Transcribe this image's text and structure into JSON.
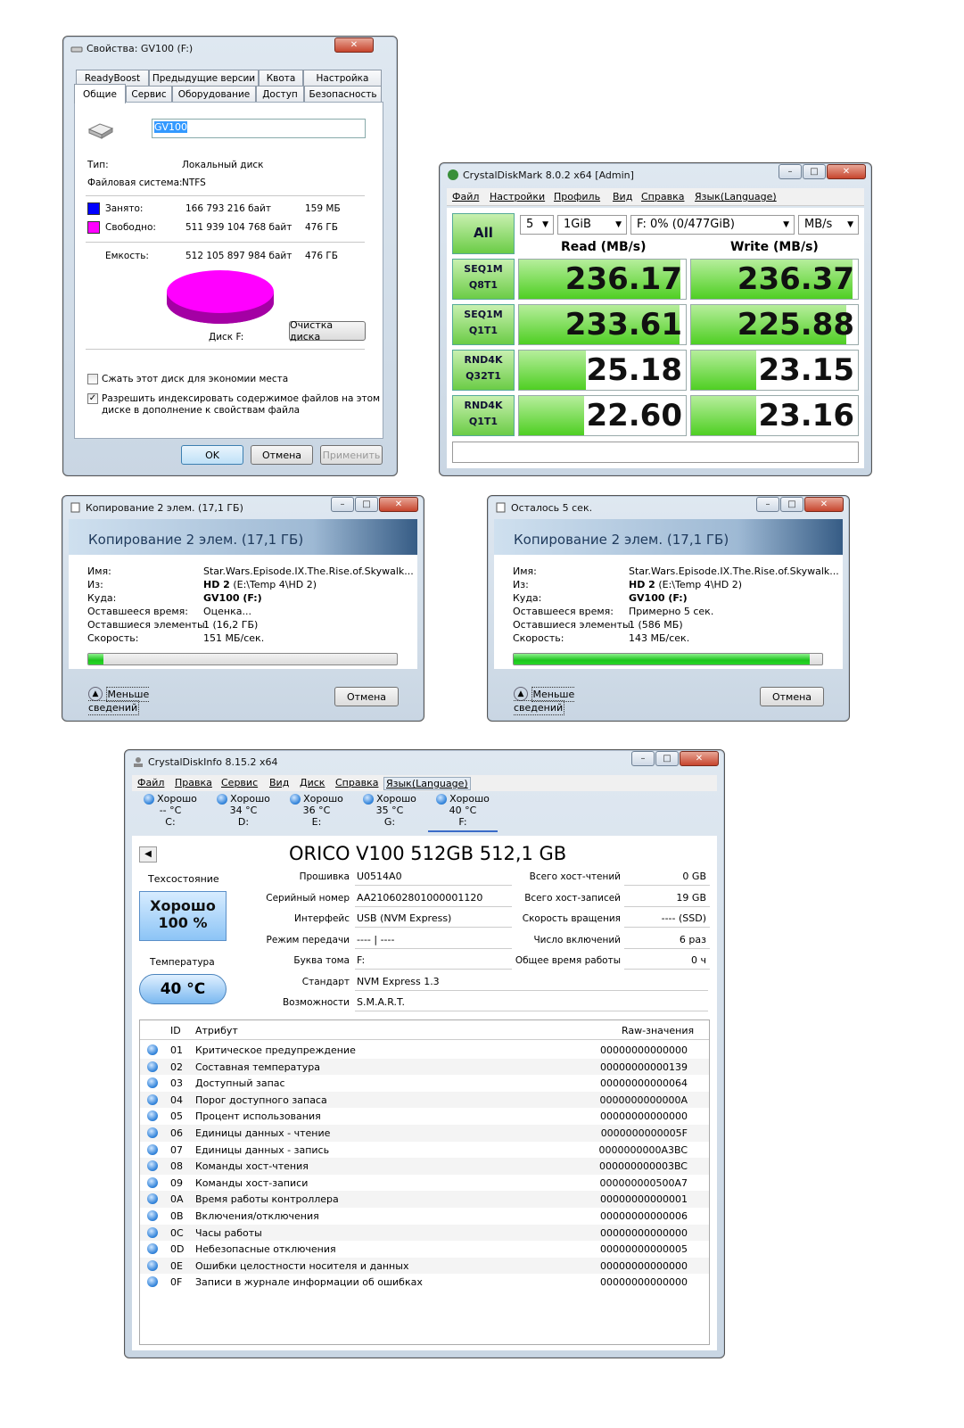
{
  "props": {
    "title": "Свойства: GV100 (F:)",
    "tabs_row1": [
      "ReadyBoost",
      "Предыдущие версии",
      "Квота",
      "Настройка"
    ],
    "tabs_row2": [
      "Общие",
      "Сервис",
      "Оборудование",
      "Доступ",
      "Безопасность"
    ],
    "name_value": "GV100",
    "type_label": "Тип:",
    "type_value": "Локальный диск",
    "fs_label": "Файловая система:",
    "fs_value": "NTFS",
    "used_label": "Занято:",
    "used_bytes": "166 793 216 байт",
    "used_short": "159 МБ",
    "free_label": "Свободно:",
    "free_bytes": "511 939 104 768 байт",
    "free_short": "476 ГБ",
    "cap_label": "Емкость:",
    "cap_bytes": "512 105 897 984 байт",
    "cap_short": "476 ГБ",
    "disk_label": "Диск F:",
    "cleanup": "Очистка диска",
    "compress": "Сжать этот диск для экономии места",
    "index1": "Разрешить индексировать содержимое файлов на этом",
    "index2": "диске в дополнение к свойствам файла",
    "ok": "OK",
    "cancel": "Отмена",
    "apply": "Применить",
    "used_color": "#0000ff",
    "free_color": "#ff00ff"
  },
  "cdm": {
    "title": "CrystalDiskMark 8.0.2 x64 [Admin]",
    "menu": [
      "Файл",
      "Настройки",
      "Профиль",
      "Вид",
      "Справка",
      "Язык(Language)"
    ],
    "all": "All",
    "count": "5",
    "size": "1GiB",
    "drive": "F: 0% (0/477GiB)",
    "unit": "MB/s",
    "read_h": "Read (MB/s)",
    "write_h": "Write (MB/s)",
    "tests": [
      {
        "l1": "SEQ1M",
        "l2": "Q8T1",
        "read": "236.17",
        "write": "236.37",
        "rf": 0.97,
        "wf": 0.97
      },
      {
        "l1": "SEQ1M",
        "l2": "Q1T1",
        "read": "233.61",
        "write": "225.88",
        "rf": 0.96,
        "wf": 0.93
      },
      {
        "l1": "RND4K",
        "l2": "Q32T1",
        "read": "25.18",
        "write": "23.15",
        "rf": 0.4,
        "wf": 0.39
      },
      {
        "l1": "RND4K",
        "l2": "Q1T1",
        "read": "22.60",
        "write": "23.16",
        "rf": 0.39,
        "wf": 0.39
      }
    ]
  },
  "copy1": {
    "title": "Копирование 2 элем. (17,1 ГБ)",
    "banner": "Копирование 2 элем. (17,1 ГБ)",
    "name_l": "Имя:",
    "name_v": "Star.Wars.Episode.IX.The.Rise.of.Skywalk...",
    "from_l": "Из:",
    "from_v1": "HD 2",
    "from_v2": " (E:\\Temp 4\\HD 2)",
    "to_l": "Куда:",
    "to_v": "GV100 (F:)",
    "time_l": "Оставшееся время:",
    "time_v": "Оценка...",
    "items_l": "Оставшиеся элементы:",
    "items_v": "1 (16,2 ГБ)",
    "speed_l": "Скорость:",
    "speed_v": "151 МБ/сек.",
    "progress": 0.05,
    "less": "Меньше сведений",
    "cancel": "Отмена"
  },
  "copy2": {
    "title": "Осталось 5 сек.",
    "banner": "Копирование 2 элем. (17,1 ГБ)",
    "name_l": "Имя:",
    "name_v": "Star.Wars.Episode.IX.The.Rise.of.Skywalk...",
    "from_l": "Из:",
    "from_v1": "HD 2",
    "from_v2": " (E:\\Temp 4\\HD 2)",
    "to_l": "Куда:",
    "to_v": "GV100 (F:)",
    "time_l": "Оставшееся время:",
    "time_v": "Примерно 5 сек.",
    "items_l": "Оставшиеся элементы:",
    "items_v": "1 (586 МБ)",
    "speed_l": "Скорость:",
    "speed_v": "143 МБ/сек.",
    "progress": 0.96,
    "less": "Меньше сведений",
    "cancel": "Отмена"
  },
  "cdi": {
    "title": "CrystalDiskInfo 8.15.2 x64",
    "menu": [
      "Файл",
      "Правка",
      "Сервис",
      "Вид",
      "Диск",
      "Справка",
      "Язык(Language)"
    ],
    "drives": [
      {
        "s": "Хорошо",
        "t": "-- °C",
        "l": "C:"
      },
      {
        "s": "Хорошо",
        "t": "34 °C",
        "l": "D:"
      },
      {
        "s": "Хорошо",
        "t": "36 °C",
        "l": "E:"
      },
      {
        "s": "Хорошо",
        "t": "35 °C",
        "l": "G:"
      },
      {
        "s": "Хорошо",
        "t": "40 °C",
        "l": "F:"
      }
    ],
    "model": "ORICO V100 512GB 512,1 GB",
    "health_l": "Техсостояние",
    "health_v": "Хорошо",
    "health_p": "100 %",
    "temp_l": "Температура",
    "temp_v": "40 °C",
    "fw_l": "Прошивка",
    "fw_v": "U0514A0",
    "sn_l": "Серийный номер",
    "sn_v": "AA210602801000001120",
    "if_l": "Интерфейс",
    "if_v": "USB (NVM Express)",
    "mode_l": "Режим передачи",
    "mode_v": "---- | ----",
    "vol_l": "Буква тома",
    "vol_v": "F:",
    "std_l": "Стандарт",
    "std_v": "NVM Express 1.3",
    "feat_l": "Возможности",
    "feat_v": "S.M.A.R.T.",
    "hr_l": "Всего хост-чтений",
    "hr_v": "0 GB",
    "hw_l": "Всего хост-записей",
    "hw_v": "19 GB",
    "rpm_l": "Скорость вращения",
    "rpm_v": "---- (SSD)",
    "pc_l": "Число включений",
    "pc_v": "6 раз",
    "poh_l": "Общее время работы",
    "poh_v": "0 ч",
    "col_id": "ID",
    "col_attr": "Атрибут",
    "col_raw": "Raw-значения",
    "attrs": [
      {
        "id": "01",
        "name": "Критическое предупреждение",
        "raw": "00000000000000"
      },
      {
        "id": "02",
        "name": "Составная температура",
        "raw": "00000000000139"
      },
      {
        "id": "03",
        "name": "Доступный запас",
        "raw": "00000000000064"
      },
      {
        "id": "04",
        "name": "Порог доступного запаса",
        "raw": "0000000000000A"
      },
      {
        "id": "05",
        "name": "Процент использования",
        "raw": "00000000000000"
      },
      {
        "id": "06",
        "name": "Единицы данных - чтение",
        "raw": "0000000000005F"
      },
      {
        "id": "07",
        "name": "Единицы данных - запись",
        "raw": "0000000000A3BC"
      },
      {
        "id": "08",
        "name": "Команды хост-чтения",
        "raw": "000000000003BC"
      },
      {
        "id": "09",
        "name": "Команды хост-записи",
        "raw": "000000000500A7"
      },
      {
        "id": "0A",
        "name": "Время работы контроллера",
        "raw": "00000000000001"
      },
      {
        "id": "0B",
        "name": "Включения/отключения",
        "raw": "00000000000006"
      },
      {
        "id": "0C",
        "name": "Часы работы",
        "raw": "00000000000000"
      },
      {
        "id": "0D",
        "name": "Небезопасные отключения",
        "raw": "00000000000005"
      },
      {
        "id": "0E",
        "name": "Ошибки целостности носителя и данных",
        "raw": "00000000000000"
      },
      {
        "id": "0F",
        "name": "Записи в журнале информации об ошибках",
        "raw": "00000000000000"
      }
    ]
  }
}
